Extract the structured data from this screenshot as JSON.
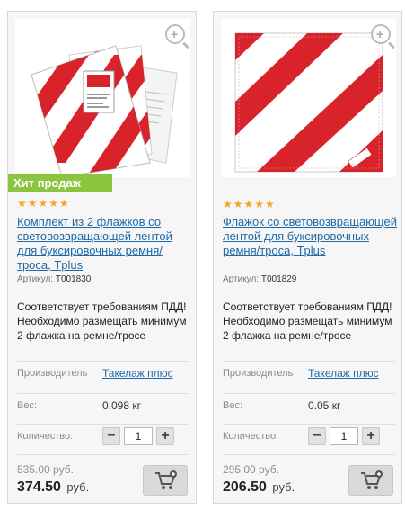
{
  "products": [
    {
      "badge": "Хит продаж",
      "rating": "★★★★★",
      "title": "Комплект из 2 флажков со световозвращающей лентой для буксировочных ремня/троса, Tplus",
      "sku_label": "Артикул:",
      "sku": "T001830",
      "description": "Соответствует требованиям ПДД! Необходимо размещать минимум 2 флажка на ремне/тросе",
      "maker_label": "Производитель",
      "maker": "Такелаж плюс",
      "weight_label": "Вес:",
      "weight": "0.098 кг",
      "qty_label": "Количество:",
      "qty": "1",
      "old_price": "535.00 руб.",
      "price": "374.50",
      "currency": "руб."
    },
    {
      "rating": "★★★★★",
      "title": "Флажок со световозвращающей лентой для буксировочных ремня/троса, Tplus",
      "sku_label": "Артикул:",
      "sku": "T001829",
      "description": "Соответствует требованиям ПДД! Необходимо размещать минимум 2 флажка на ремне/тросе",
      "maker_label": "Производитель",
      "maker": "Такелаж плюс",
      "weight_label": "Вес:",
      "weight": "0.05 кг",
      "qty_label": "Количество:",
      "qty": "1",
      "old_price": "295.00 руб.",
      "price": "206.50",
      "currency": "руб."
    }
  ],
  "colors": {
    "accent_green": "#8bc53f",
    "link": "#1e6aa8",
    "star": "#f5a623",
    "flag_red": "#d8232a"
  },
  "icons": {
    "zoom": "magnifier-plus-icon",
    "cart": "add-to-cart-icon",
    "minus": "minus-icon",
    "plus": "plus-icon"
  }
}
